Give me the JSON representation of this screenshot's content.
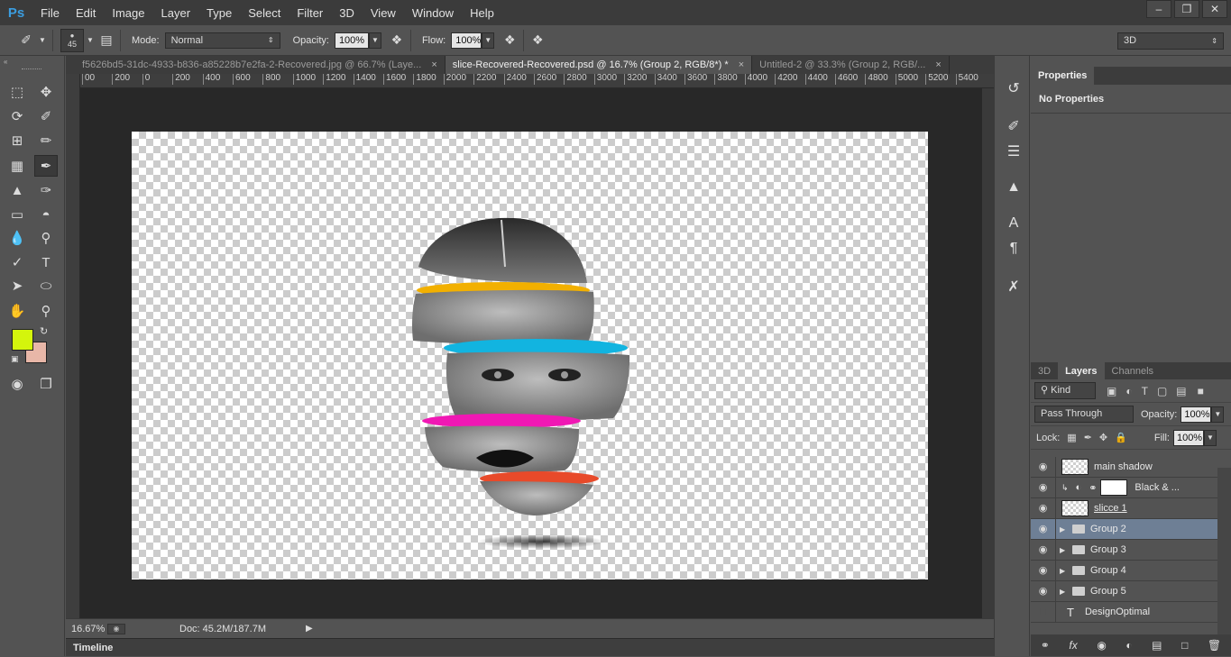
{
  "app": {
    "logo": "Ps",
    "menu": [
      "File",
      "Edit",
      "Image",
      "Layer",
      "Type",
      "Select",
      "Filter",
      "3D",
      "View",
      "Window",
      "Help"
    ]
  },
  "options_bar": {
    "brush_size": "45",
    "mode_label": "Mode:",
    "mode_value": "Normal",
    "opacity_label": "Opacity:",
    "opacity_value": "100%",
    "flow_label": "Flow:",
    "flow_value": "100%",
    "workspace": "3D"
  },
  "tabs": [
    {
      "label": "f5626bd5-31dc-4933-b836-a85228b7e2fa-2-Recovered.jpg @ 66.7% (Laye...",
      "active": false
    },
    {
      "label": "slice-Recovered-Recovered.psd @ 16.7% (Group 2, RGB/8*) *",
      "active": true
    },
    {
      "label": "Untitled-2 @ 33.3% (Group 2, RGB/...",
      "active": false
    }
  ],
  "ruler_ticks": [
    "00",
    "200",
    "0",
    "200",
    "400",
    "600",
    "800",
    "1000",
    "1200",
    "1400",
    "1600",
    "1800",
    "2000",
    "2200",
    "2400",
    "2600",
    "2800",
    "3000",
    "3200",
    "3400",
    "3600",
    "3800",
    "4000",
    "4200",
    "4400",
    "4600",
    "4800",
    "5000",
    "5200",
    "5400"
  ],
  "status": {
    "zoom": "16.67%",
    "doc": "Doc: 45.2M/187.7M"
  },
  "timeline_label": "Timeline",
  "colors": {
    "foreground": "#d4f50c",
    "background": "#e8b7a8",
    "accent_yellow": "#f2b000",
    "accent_cyan": "#12b4e0",
    "accent_magenta": "#f018b4",
    "accent_red": "#e84a2a"
  },
  "properties": {
    "tab": "Properties",
    "header": "No Properties"
  },
  "layers_panel": {
    "tabs": [
      "3D",
      "Layers",
      "Channels"
    ],
    "filter_kind": "Kind",
    "blend_mode": "Pass Through",
    "opacity_label": "Opacity:",
    "opacity_value": "100%",
    "lock_label": "Lock:",
    "fill_label": "Fill:",
    "fill_value": "100%",
    "layers": [
      {
        "name": "main shadow",
        "type": "pixel",
        "selected": false
      },
      {
        "name": "Black & ...",
        "type": "adjustment",
        "selected": false
      },
      {
        "name": "slicce 1",
        "type": "pixel",
        "selected": false
      },
      {
        "name": "Group 2",
        "type": "group",
        "selected": true
      },
      {
        "name": "Group 3",
        "type": "group",
        "selected": false
      },
      {
        "name": "Group 4",
        "type": "group",
        "selected": false
      },
      {
        "name": "Group 5",
        "type": "group",
        "selected": false
      },
      {
        "name": "DesignOptimal",
        "type": "text",
        "selected": false
      }
    ],
    "footer_icons": [
      "link-icon",
      "fx-icon",
      "mask-icon",
      "adjustment-icon",
      "folder-icon",
      "new-layer-icon",
      "trash-icon"
    ]
  }
}
